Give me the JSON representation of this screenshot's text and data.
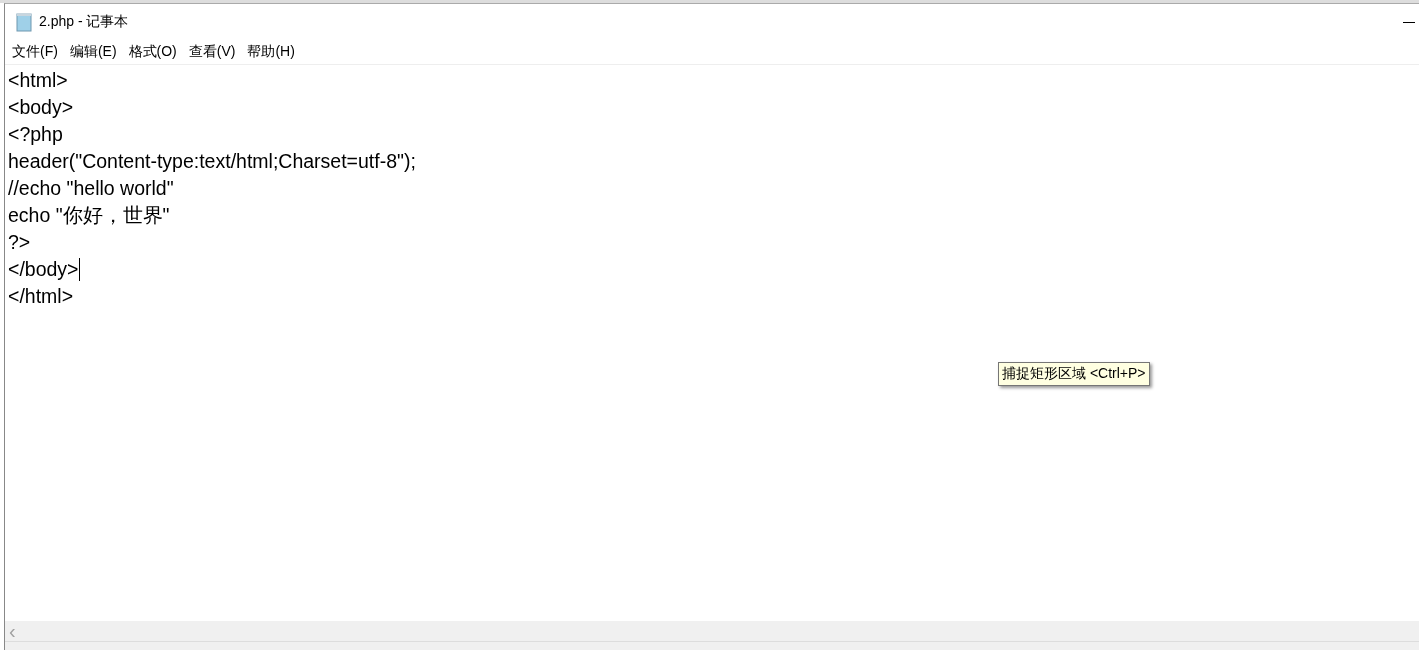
{
  "window": {
    "title": "2.php - 记事本"
  },
  "menu": [
    "文件(F)",
    "编辑(E)",
    "格式(O)",
    "查看(V)",
    "帮助(H)"
  ],
  "editor": {
    "lines": [
      {
        "text": "<html>",
        "caret": false
      },
      {
        "text": "<body>",
        "caret": false
      },
      {
        "text": "<?php",
        "caret": false
      },
      {
        "text": "header(\"Content-type:text/html;Charset=utf-8\");",
        "caret": false
      },
      {
        "text": "//echo \"hello world\"",
        "caret": false
      },
      {
        "text": "echo \"你好，世界\"",
        "caret": false
      },
      {
        "text": "?>",
        "caret": false
      },
      {
        "text": "</body>",
        "caret": true
      },
      {
        "text": "</html>",
        "caret": false
      }
    ]
  },
  "tooltip": {
    "text": "捕捉矩形区域 <Ctrl+P>"
  },
  "scrollbar": {
    "arrow": "‹"
  }
}
